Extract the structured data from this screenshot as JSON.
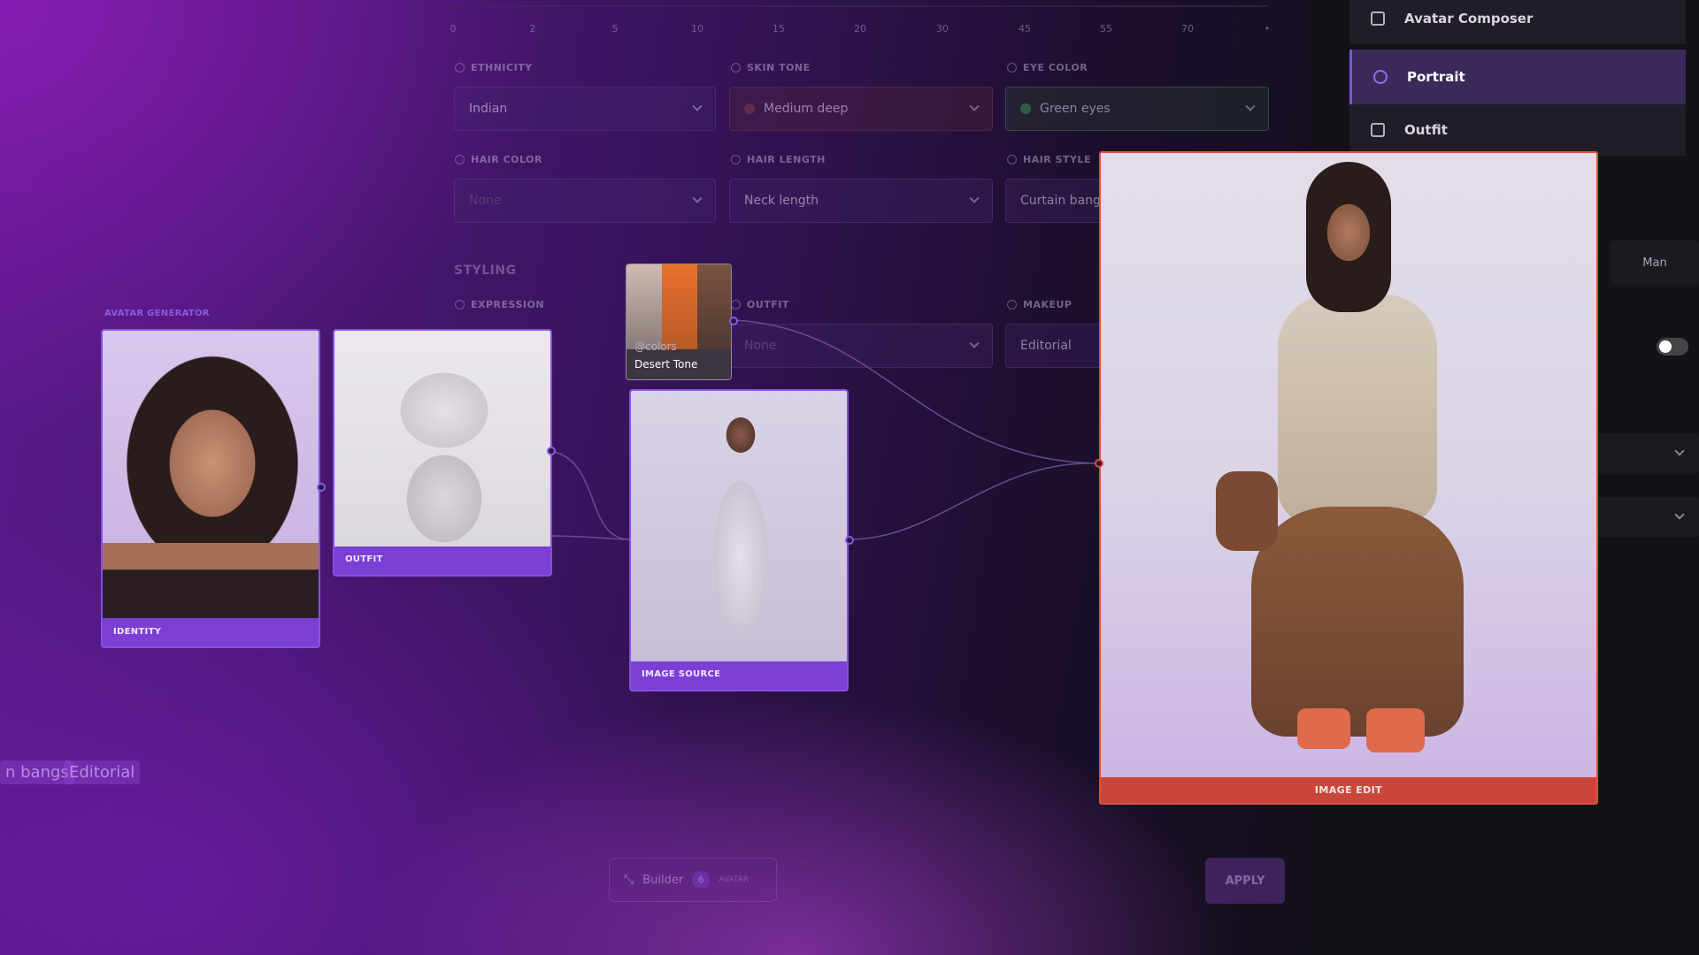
{
  "slider": {
    "ticks": [
      "0",
      "2",
      "5",
      "10",
      "15",
      "20",
      "30",
      "45",
      "55",
      "70",
      "•"
    ]
  },
  "form": {
    "ethnicity": {
      "label": "ETHNICITY",
      "value": "Indian"
    },
    "skin_tone": {
      "label": "SKIN TONE",
      "value": "Medium deep",
      "color": "#7a3a3a"
    },
    "eye_color": {
      "label": "EYE COLOR",
      "value": "Green eyes",
      "color": "#3c9a4a"
    },
    "hair_color": {
      "label": "HAIR COLOR",
      "value": "None"
    },
    "hair_length": {
      "label": "HAIR LENGTH",
      "value": "Neck length"
    },
    "hair_style": {
      "label": "HAIR STYLE",
      "value": "Curtain bangs"
    },
    "styling_title": "STYLING",
    "expression": {
      "label": "EXPRESSION"
    },
    "outfit": {
      "label": "OUTFIT",
      "value": "None"
    },
    "makeup": {
      "label": "MAKEUP",
      "value": "Editorial"
    }
  },
  "right_panel": {
    "items": [
      {
        "label": "Avatar Composer",
        "icon": "grid-icon"
      },
      {
        "label": "Portrait",
        "icon": "person-icon",
        "active": true
      },
      {
        "label": "Outfit",
        "icon": "shirt-icon"
      }
    ],
    "segment_label": "Man"
  },
  "nodes": {
    "group_label": "AVATAR GENERATOR",
    "identity": "IDENTITY",
    "outfit": "OUTFIT",
    "color_tag": "@colors",
    "color_name": "Desert Tone",
    "image_source": "IMAGE SOURCE",
    "image_edit": "IMAGE EDIT"
  },
  "tags": [
    "n bangs",
    "Editorial"
  ],
  "bottom_bar": {
    "builder_label": "Builder",
    "builder_count": "6",
    "avatar_label": "AVATAR",
    "apply_label": "APPLY"
  },
  "colors": {
    "accent": "#7b3fd6",
    "edit_border": "#d9533a",
    "swatch1": "#e06a2a",
    "swatch2": "#6d4a3a",
    "swatch3": "#c9b8b0"
  }
}
